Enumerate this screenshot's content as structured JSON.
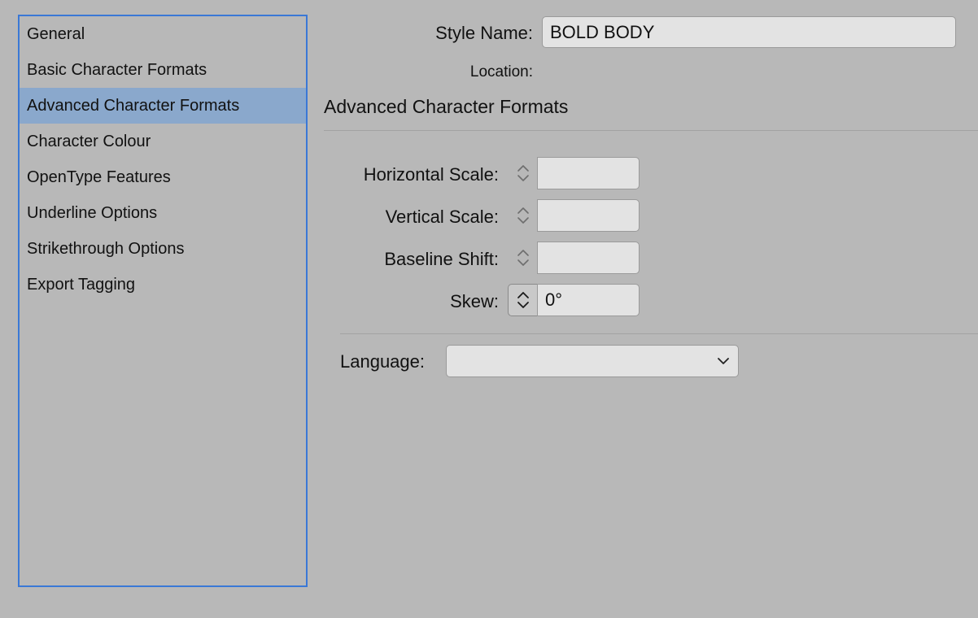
{
  "sidebar": {
    "items": [
      {
        "label": "General",
        "selected": false
      },
      {
        "label": "Basic Character Formats",
        "selected": false
      },
      {
        "label": "Advanced Character Formats",
        "selected": true
      },
      {
        "label": "Character Colour",
        "selected": false
      },
      {
        "label": "OpenType Features",
        "selected": false
      },
      {
        "label": "Underline Options",
        "selected": false
      },
      {
        "label": "Strikethrough Options",
        "selected": false
      },
      {
        "label": "Export Tagging",
        "selected": false
      }
    ]
  },
  "header": {
    "style_name_label": "Style Name:",
    "style_name_value": "BOLD BODY",
    "location_label": "Location:"
  },
  "section": {
    "title": "Advanced Character Formats"
  },
  "fields": {
    "horizontal_scale": {
      "label": "Horizontal Scale:",
      "value": ""
    },
    "vertical_scale": {
      "label": "Vertical Scale:",
      "value": ""
    },
    "baseline_shift": {
      "label": "Baseline Shift:",
      "value": ""
    },
    "skew": {
      "label": "Skew:",
      "value": "0°"
    }
  },
  "language": {
    "label": "Language:",
    "selected": ""
  },
  "icons": {
    "stepper": "chevron-up-down-icon",
    "dropdown": "chevron-down-icon"
  },
  "colors": {
    "background": "#b8b8b8",
    "sidebar_border": "#3a78d6",
    "selected_item": "#8aa8cc",
    "field_background": "#e3e3e3"
  }
}
